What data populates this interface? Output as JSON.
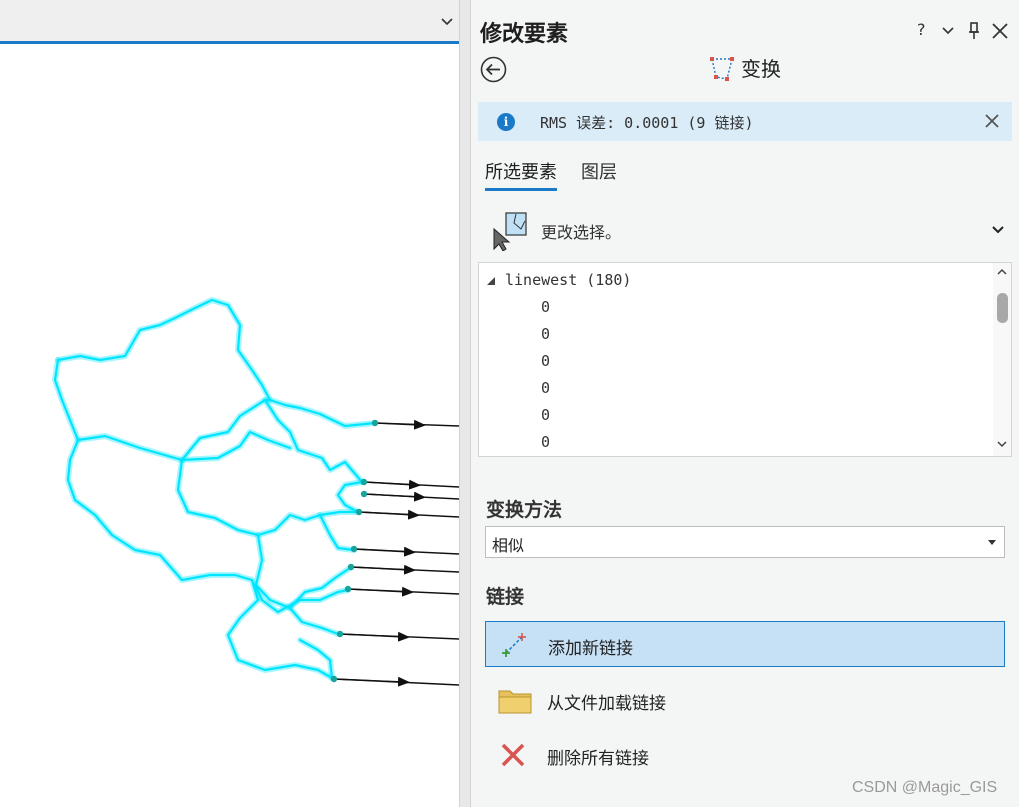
{
  "pane": {
    "title": "修改要素",
    "controls": {
      "help": "?",
      "menu_icon": "chevron-down-icon",
      "pin_icon": "pin-icon",
      "close_icon": "close-icon"
    },
    "tool_name": "变换"
  },
  "message": {
    "text": "RMS 误差: 0.0001 (9 链接)",
    "icon": "info-icon"
  },
  "tabs": [
    {
      "label": "所选要素",
      "selected": true
    },
    {
      "label": "图层",
      "selected": false
    }
  ],
  "selection": {
    "label": "更改选择。"
  },
  "feature_list": {
    "layer": "linewest (180)",
    "items": [
      "0",
      "0",
      "0",
      "0",
      "0",
      "0"
    ]
  },
  "method": {
    "title": "变换方法",
    "value": "相似"
  },
  "links": {
    "title": "链接",
    "actions": [
      {
        "label": "添加新链接",
        "icon": "add-link-icon",
        "active": true
      },
      {
        "label": "从文件加载链接",
        "icon": "folder-icon",
        "active": false
      },
      {
        "label": "删除所有链接",
        "icon": "delete-x-icon",
        "active": false
      }
    ]
  },
  "watermark": "CSDN @Magic_GIS",
  "colors": {
    "accent": "#1a7ac7",
    "map_boundary": "#00e5ff",
    "message_bg": "#d9ecf8",
    "active_action_bg": "#c6e0f5",
    "delete_icon": "#d9534f",
    "folder_icon": "#e6c05c"
  }
}
